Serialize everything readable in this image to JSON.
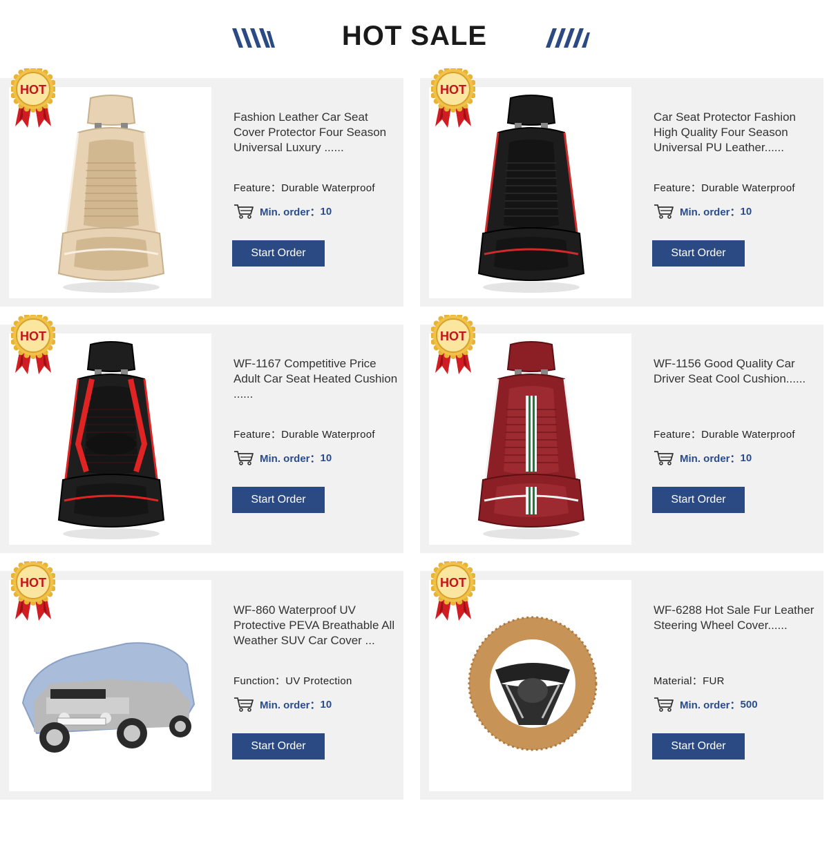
{
  "header": {
    "title": "HOT SALE",
    "accent_color": "#2b4a84"
  },
  "badge_text": "HOT",
  "products": [
    {
      "title": "Fashion Leather Car Seat Cover Protector Four Season Universal Luxury ......",
      "attr_label": "Feature：",
      "attr_value": "Durable Waterproof",
      "min_label": "Min. order：",
      "min_value": "10",
      "button": "Start Order",
      "image": "beige-seat-cover"
    },
    {
      "title": "Car Seat Protector Fashion High Quality Four Season Universal PU Leather......",
      "attr_label": "Feature：",
      "attr_value": "Durable Waterproof",
      "min_label": "Min. order：",
      "min_value": "10",
      "button": "Start Order",
      "image": "black-red-seat-cover"
    },
    {
      "title": "WF-1167 Competitive Price Adult Car Seat Heated Cushion ......",
      "attr_label": "Feature：",
      "attr_value": "Durable Waterproof",
      "min_label": "Min. order：",
      "min_value": "10",
      "button": "Start Order",
      "image": "black-red-sport-seat"
    },
    {
      "title": "WF-1156 Good Quality Car Driver Seat Cool Cushion......",
      "attr_label": "Feature：",
      "attr_value": "Durable Waterproof",
      "min_label": "Min. order：",
      "min_value": "10",
      "button": "Start Order",
      "image": "burgundy-seat-cover"
    },
    {
      "title": "WF-860 Waterproof UV Protective PEVA Breathable All Weather SUV Car Cover ...",
      "attr_label": "Function：",
      "attr_value": "UV Protection",
      "min_label": "Min. order：",
      "min_value": "10",
      "button": "Start Order",
      "image": "suv-car-cover"
    },
    {
      "title": "WF-6288 Hot Sale Fur Leather Steering Wheel Cover......",
      "attr_label": "Material：",
      "attr_value": "FUR",
      "min_label": "Min. order：",
      "min_value": "500",
      "button": "Start Order",
      "image": "fur-steering-wheel-cover"
    }
  ]
}
